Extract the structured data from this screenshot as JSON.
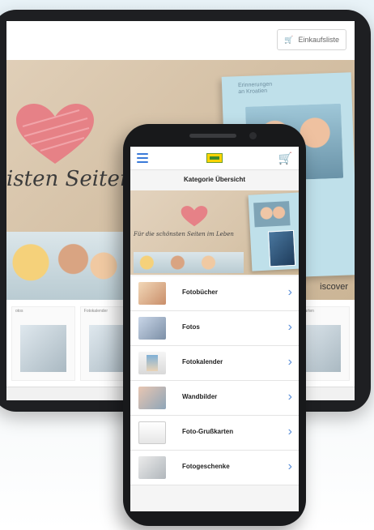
{
  "tablet": {
    "cart_label": "Einkaufsliste",
    "hero": {
      "headline": "isten Seiten i",
      "album_title": "Erinnerungen\nan Kroatien",
      "discover": "iscover"
    },
    "products": [
      {
        "label": "otos"
      },
      {
        "label": "Fotokalender"
      },
      {
        "label": ""
      },
      {
        "label": ""
      },
      {
        "label": "o-Grußkarten"
      }
    ]
  },
  "phone": {
    "page_title": "Kategorie Übersicht",
    "banner_text": "Für die schönsten Seiten im Leben",
    "categories": [
      {
        "label": "Fotobücher"
      },
      {
        "label": "Fotos"
      },
      {
        "label": "Fotokalender"
      },
      {
        "label": "Wandbilder"
      },
      {
        "label": "Foto-Grußkarten"
      },
      {
        "label": "Fotogeschenke"
      }
    ],
    "colors": {
      "accent": "#3a7ad8",
      "chevron": "#5b8fd8",
      "heart": "#e8747f"
    }
  }
}
